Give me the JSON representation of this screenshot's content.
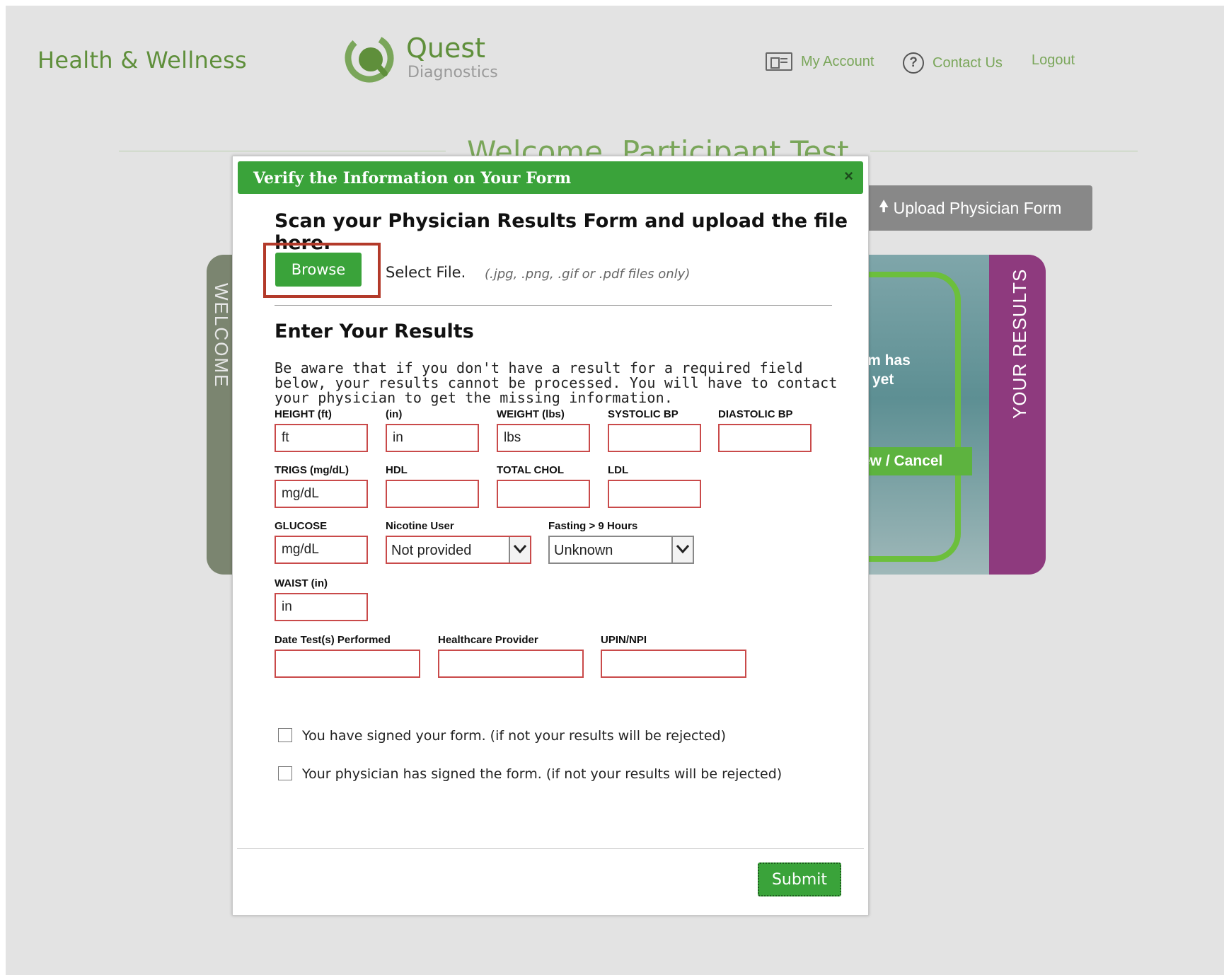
{
  "header": {
    "brand": "Health & Wellness",
    "logo_name": "Quest",
    "logo_sub": "Diagnostics",
    "nav": {
      "my_account": "My Account",
      "contact_us": "Contact Us",
      "logout": "Logout"
    }
  },
  "background": {
    "welcome_title": "Welcome, Participant Test",
    "upload_button": "Upload Physician Form",
    "welcome_tab": "WELCOME",
    "results_tab": "YOUR RESULTS",
    "photo_text_1": "rm has",
    "photo_text_2": "yet",
    "photo_button": "ew / Cancel"
  },
  "modal": {
    "title": "Verify the Information on Your Form",
    "close": "×",
    "scan_heading": "Scan your Physician Results Form and upload the file here.",
    "browse": "Browse",
    "select_file": "Select File.",
    "file_types": "(.jpg, .png, .gif or .pdf files only)",
    "enter_heading": "Enter Your Results",
    "notice": "Be aware that if you don't have a result for a required field below, your results cannot be processed. You will have to contact your physician to get the missing information.",
    "fields": {
      "height_ft": {
        "label": "HEIGHT (ft)",
        "placeholder": "ft"
      },
      "height_in": {
        "label": "(in)",
        "placeholder": "in"
      },
      "weight": {
        "label": "WEIGHT (lbs)",
        "placeholder": "lbs"
      },
      "systolic": {
        "label": "SYSTOLIC BP",
        "placeholder": ""
      },
      "diastolic": {
        "label": "DIASTOLIC BP",
        "placeholder": ""
      },
      "trigs": {
        "label": "TRIGS (mg/dL)",
        "placeholder": "mg/dL"
      },
      "hdl": {
        "label": "HDL",
        "placeholder": ""
      },
      "total_chol": {
        "label": "TOTAL CHOL",
        "placeholder": ""
      },
      "ldl": {
        "label": "LDL",
        "placeholder": ""
      },
      "glucose": {
        "label": "GLUCOSE",
        "placeholder": "mg/dL"
      },
      "nicotine": {
        "label": "Nicotine User",
        "value": "Not provided"
      },
      "fasting": {
        "label": "Fasting > 9 Hours",
        "value": "Unknown"
      },
      "waist": {
        "label": "WAIST (in)",
        "placeholder": "in"
      },
      "date": {
        "label": "Date Test(s) Performed",
        "placeholder": ""
      },
      "provider": {
        "label": "Healthcare Provider",
        "placeholder": ""
      },
      "upin": {
        "label": "UPIN/NPI",
        "placeholder": ""
      }
    },
    "checkbox_1": "You have signed your form. (if not your results will be rejected)",
    "checkbox_2": "Your physician has signed the form. (if not your results will be rejected)",
    "submit": "Submit"
  }
}
